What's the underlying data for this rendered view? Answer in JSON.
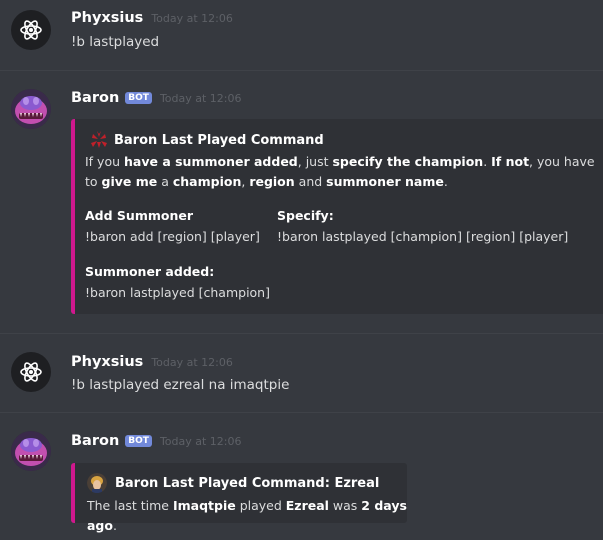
{
  "colors": {
    "background": "#36393f",
    "embed_accent": "#d0188e",
    "bot_badge": "#7289da"
  },
  "messages": [
    {
      "author": "Phyxsius",
      "timestamp": "Today at 12:06",
      "text": "!b lastplayed",
      "avatar_icon": "atom-icon"
    },
    {
      "author": "Baron",
      "badge": "BOT",
      "timestamp": "Today at 12:06",
      "avatar_icon": "baron-nashor-icon",
      "embed": {
        "title": "Baron Last Played Command",
        "title_icon": "baron-emblem-icon",
        "description": [
          {
            "t": "If you ",
            "b": false
          },
          {
            "t": "have a summoner added",
            "b": true
          },
          {
            "t": ", just ",
            "b": false
          },
          {
            "t": "specify the champion",
            "b": true
          },
          {
            "t": ". ",
            "b": false
          },
          {
            "t": "If not",
            "b": true
          },
          {
            "t": ", you have to ",
            "b": false
          },
          {
            "t": "give me",
            "b": true
          },
          {
            "t": " a ",
            "b": false
          },
          {
            "t": "champion",
            "b": true
          },
          {
            "t": ", ",
            "b": false
          },
          {
            "t": "region",
            "b": true
          },
          {
            "t": " and ",
            "b": false
          },
          {
            "t": "summoner name",
            "b": true
          },
          {
            "t": ".",
            "b": false
          }
        ],
        "fields": [
          {
            "name": "Add Summoner",
            "value": "!baron add [region] [player]"
          },
          {
            "name": "Specify:",
            "value": "!baron lastplayed [champion] [region] [player]"
          },
          {
            "name": "Summoner added:",
            "value": "!baron lastplayed [champion]"
          }
        ]
      }
    },
    {
      "author": "Phyxsius",
      "timestamp": "Today at 12:06",
      "text": "!b lastplayed ezreal na imaqtpie",
      "avatar_icon": "atom-icon"
    },
    {
      "author": "Baron",
      "badge": "BOT",
      "timestamp": "Today at 12:06",
      "avatar_icon": "baron-nashor-icon",
      "embed": {
        "title": "Baron Last Played Command: Ezreal",
        "title_icon": "ezreal-portrait-icon",
        "description": [
          {
            "t": "The last time ",
            "b": false
          },
          {
            "t": "Imaqtpie",
            "b": true
          },
          {
            "t": " played ",
            "b": false
          },
          {
            "t": "Ezreal",
            "b": true
          },
          {
            "t": " was ",
            "b": false
          },
          {
            "t": "2 days ago",
            "b": true
          },
          {
            "t": ".",
            "b": false
          }
        ]
      }
    }
  ]
}
